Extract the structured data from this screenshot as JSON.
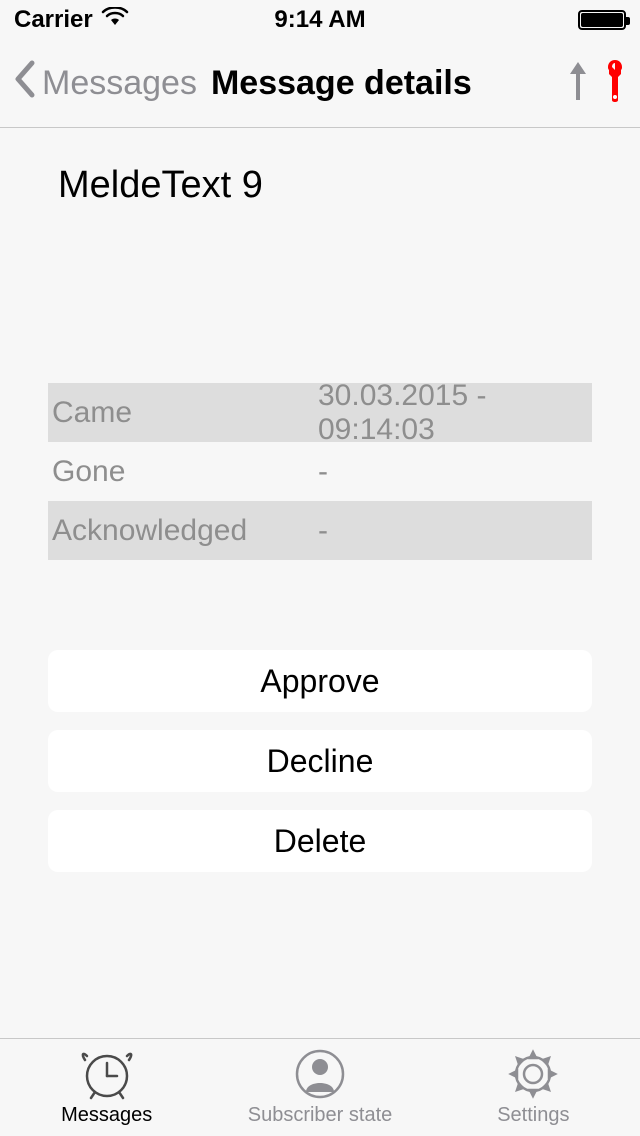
{
  "status_bar": {
    "carrier": "Carrier",
    "time": "9:14 AM"
  },
  "nav": {
    "back_label": "Messages",
    "title": "Message details"
  },
  "message": {
    "title": "MeldeText 9"
  },
  "info": {
    "rows": [
      {
        "label": "Came",
        "value": "30.03.2015 - 09:14:03"
      },
      {
        "label": "Gone",
        "value": "-"
      },
      {
        "label": "Acknowledged",
        "value": "-"
      }
    ]
  },
  "buttons": {
    "approve": "Approve",
    "decline": "Decline",
    "delete": "Delete"
  },
  "tabs": {
    "messages": "Messages",
    "subscriber": "Subscriber state",
    "settings": "Settings"
  }
}
